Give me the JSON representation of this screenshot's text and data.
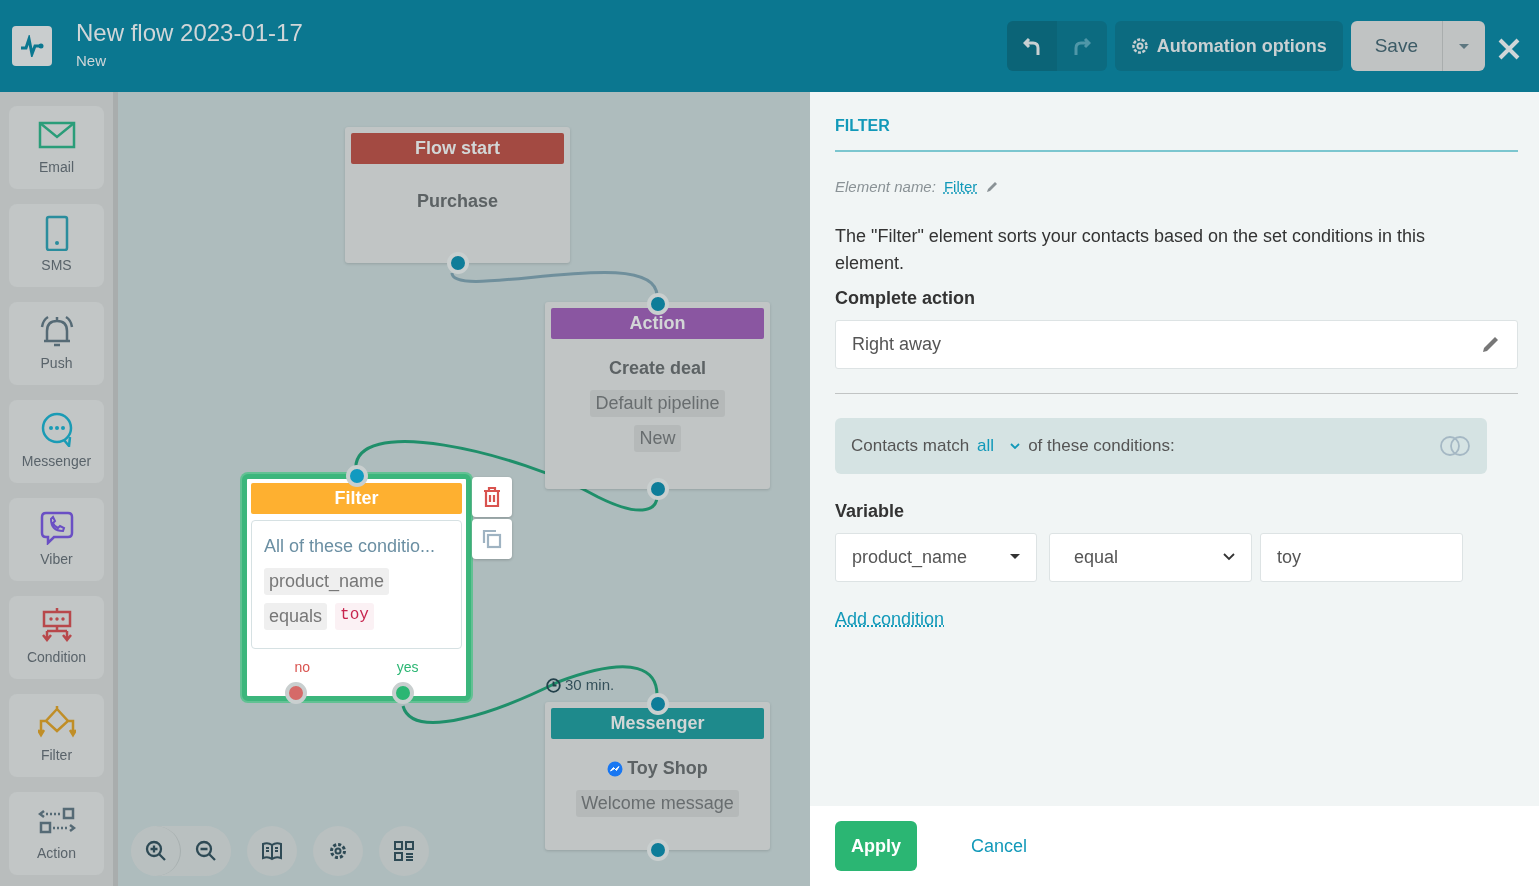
{
  "header": {
    "title": "New flow 2023-01-17",
    "subtitle": "New",
    "undo_disabled": false,
    "redo_disabled": true,
    "options_label": "Automation options",
    "save_label": "Save"
  },
  "sidebar": {
    "items": [
      {
        "kind": "email",
        "label": "Email"
      },
      {
        "kind": "sms",
        "label": "SMS"
      },
      {
        "kind": "push",
        "label": "Push"
      },
      {
        "kind": "messenger",
        "label": "Messenger"
      },
      {
        "kind": "viber",
        "label": "Viber"
      },
      {
        "kind": "condition",
        "label": "Condition"
      },
      {
        "kind": "filter",
        "label": "Filter"
      },
      {
        "kind": "action",
        "label": "Action"
      }
    ]
  },
  "canvas": {
    "nodes": [
      {
        "kind": "start",
        "title": "Flow start",
        "selected": false,
        "main": "Purchase"
      },
      {
        "kind": "action",
        "title": "Action",
        "selected": false,
        "main": "Create deal",
        "tags": [
          [
            "Default pipeline"
          ],
          [
            "New"
          ]
        ]
      },
      {
        "kind": "filter",
        "title": "Filter",
        "selected": true,
        "main": "All of these conditio...",
        "tags": [
          [
            "product_name"
          ],
          [
            "equals",
            "toy"
          ]
        ],
        "outputs": [
          "no",
          "yes"
        ]
      },
      {
        "kind": "messenger",
        "title": "Messenger",
        "selected": false,
        "main": "Toy Shop",
        "tags": [
          [
            "Welcome message"
          ]
        ],
        "delay": "30 min."
      }
    ]
  },
  "panel": {
    "title": "FILTER",
    "element_name_label": "Element name:",
    "element_name": "Filter",
    "description": "The \"Filter\" element sorts your contacts based on the set conditions in this element.",
    "complete_action_label": "Complete action",
    "complete_action": "Right away",
    "match_prefix": "Contacts match",
    "match_value": "all",
    "match_suffix": "of these conditions:",
    "variable_label": "Variable",
    "condition": {
      "field": "product_name",
      "operator": "equal",
      "value": "toy"
    },
    "add_condition": "Add condition",
    "apply": "Apply",
    "cancel": "Cancel"
  }
}
